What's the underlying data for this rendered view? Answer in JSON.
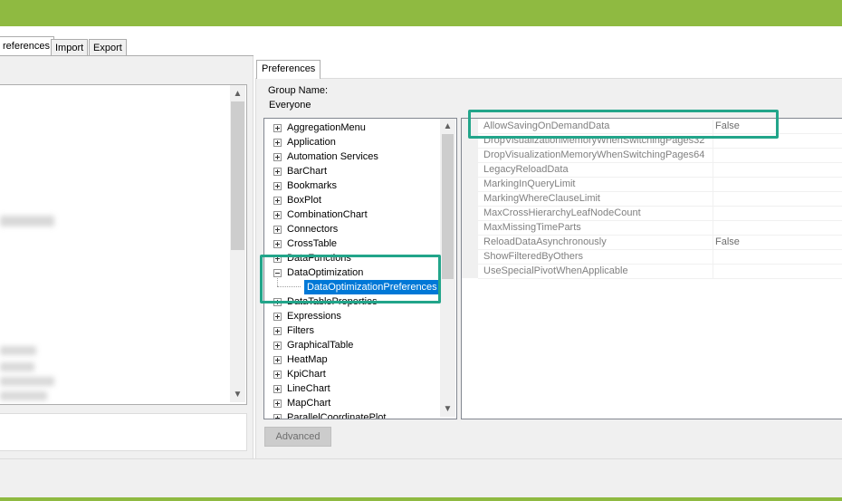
{
  "outer_tabs": [
    {
      "label": "references",
      "active": true
    },
    {
      "label": "Import",
      "active": false
    },
    {
      "label": "Export",
      "active": false
    }
  ],
  "preferences_tab": {
    "label": "Preferences"
  },
  "group": {
    "label": "Group Name:",
    "value": "Everyone"
  },
  "tree": {
    "items": [
      {
        "label": "AggregationMenu",
        "expanded": false
      },
      {
        "label": "Application",
        "expanded": false
      },
      {
        "label": "Automation Services",
        "expanded": false
      },
      {
        "label": "BarChart",
        "expanded": false
      },
      {
        "label": "Bookmarks",
        "expanded": false
      },
      {
        "label": "BoxPlot",
        "expanded": false
      },
      {
        "label": "CombinationChart",
        "expanded": false
      },
      {
        "label": "Connectors",
        "expanded": false
      },
      {
        "label": "CrossTable",
        "expanded": false
      },
      {
        "label": "DataFunctions",
        "expanded": false
      },
      {
        "label": "DataOptimization",
        "expanded": true
      },
      {
        "label": "DataOptimizationPreferences",
        "selected": true,
        "child": true
      },
      {
        "label": "DataTableProperties",
        "expanded": false
      },
      {
        "label": "Expressions",
        "expanded": false
      },
      {
        "label": "Filters",
        "expanded": false
      },
      {
        "label": "GraphicalTable",
        "expanded": false
      },
      {
        "label": "HeatMap",
        "expanded": false
      },
      {
        "label": "KpiChart",
        "expanded": false
      },
      {
        "label": "LineChart",
        "expanded": false
      },
      {
        "label": "MapChart",
        "expanded": false
      },
      {
        "label": "ParallelCoordinatePlot",
        "expanded": false
      }
    ]
  },
  "properties": [
    {
      "name": "AllowSavingOnDemandData",
      "value": "False"
    },
    {
      "name": "DropVisualizationMemoryWhenSwitchingPages32",
      "value": ""
    },
    {
      "name": "DropVisualizationMemoryWhenSwitchingPages64",
      "value": ""
    },
    {
      "name": "LegacyReloadData",
      "value": ""
    },
    {
      "name": "MarkingInQueryLimit",
      "value": ""
    },
    {
      "name": "MarkingWhereClauseLimit",
      "value": ""
    },
    {
      "name": "MaxCrossHierarchyLeafNodeCount",
      "value": ""
    },
    {
      "name": "MaxMissingTimeParts",
      "value": ""
    },
    {
      "name": "ReloadDataAsynchronously",
      "value": "False"
    },
    {
      "name": "ShowFilteredByOthers",
      "value": ""
    },
    {
      "name": "UseSpecialPivotWhenApplicable",
      "value": ""
    }
  ],
  "buttons": {
    "advanced": "Advanced"
  },
  "colors": {
    "accent_bar": "#8fba41",
    "highlight": "#22a58a",
    "selection": "#0078d7"
  }
}
